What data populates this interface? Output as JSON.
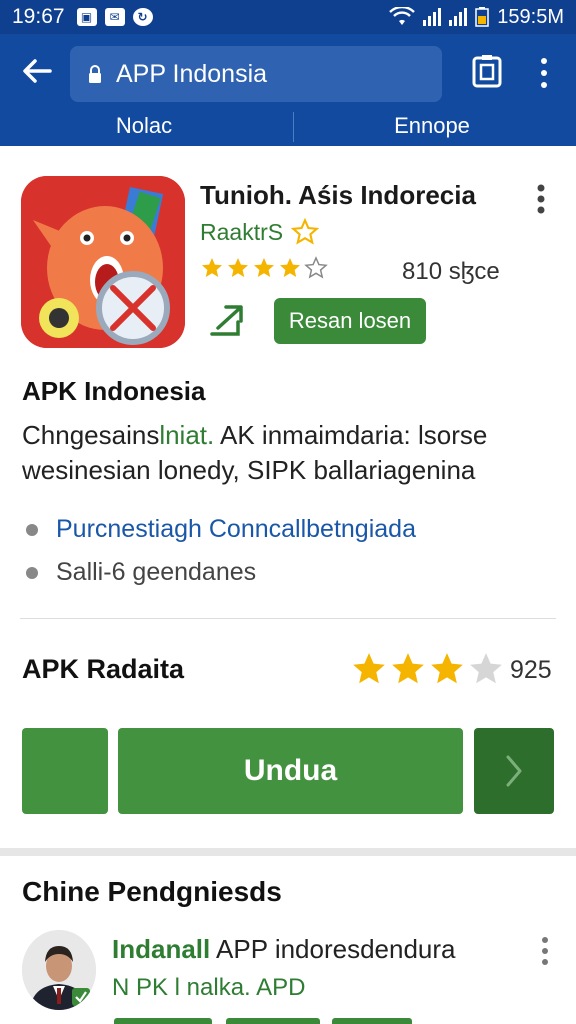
{
  "status_bar": {
    "time": "19:67",
    "clock_right": "159:5M"
  },
  "search": {
    "url_text": "APP Indonsia"
  },
  "tabs": [
    {
      "label": "Nolac"
    },
    {
      "label": "Ennope"
    }
  ],
  "app": {
    "title": "Tunioh. Aśis Indorecia",
    "developer": "RaaktrS",
    "rating_stars": 4,
    "size_text": "810 sɮce",
    "install_label": "Resan losen"
  },
  "description": {
    "title": "APK Indonesia",
    "text_part1": "Chngesains",
    "text_highlight": "lniat.",
    "text_part2": " AK inmaimdaria: lsorse wesinesian lonedy, SIPK ballariagenina",
    "bullets": [
      "Purcnestiagh Conncallbetngiada",
      "Salli-6 geendanes"
    ]
  },
  "rating_section": {
    "label": "APK Radaita",
    "stars": 3,
    "count": "925"
  },
  "download": {
    "label": "Undua"
  },
  "similar": {
    "title": "Chine Pendgniesds",
    "item": {
      "brand": "Indanall",
      "title_rest": " APP indoresdendura",
      "subtitle": "N PK l nalka. APD"
    }
  },
  "colors": {
    "app_bar": "#114a9e",
    "accent_green": "#43923f",
    "link_blue": "#1a57a8",
    "star": "#f5b400"
  }
}
